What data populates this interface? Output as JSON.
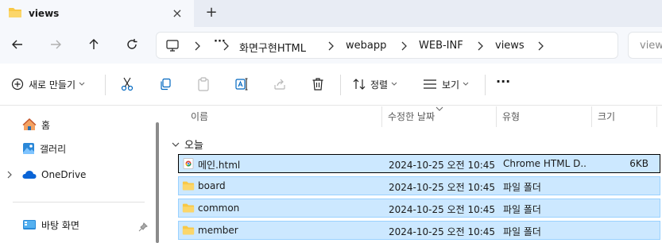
{
  "window": {
    "tab_title": "views",
    "close_glyph": "×",
    "newtab_glyph": "+"
  },
  "address": {
    "more": "···",
    "crumbs": [
      "화면구현HTML",
      "webapp",
      "WEB-INF",
      "views"
    ],
    "search_placeholder": "view"
  },
  "toolbar": {
    "new_label": "새로 만들기",
    "sort_label": "정렬",
    "view_label": "보기",
    "more_glyph": "···"
  },
  "nav": {
    "items": [
      {
        "label": "홈",
        "icon": "home-icon"
      },
      {
        "label": "갤러리",
        "icon": "gallery-icon"
      },
      {
        "label": "OneDrive",
        "icon": "cloud-icon"
      },
      {
        "label": "바탕 화면",
        "icon": "desktop-icon"
      }
    ]
  },
  "columns": {
    "name": "이름",
    "date": "수정한 날짜",
    "type": "유형",
    "size": "크기"
  },
  "group": {
    "label": "오늘"
  },
  "files": [
    {
      "name": "메인.html",
      "date": "2024-10-25 오전 10:45",
      "type": "Chrome HTML D...",
      "size": "6KB",
      "icon": "chrome-html-icon"
    },
    {
      "name": "board",
      "date": "2024-10-25 오전 10:45",
      "type": "파일 폴더",
      "size": "",
      "icon": "folder-icon"
    },
    {
      "name": "common",
      "date": "2024-10-25 오전 10:45",
      "type": "파일 폴더",
      "size": "",
      "icon": "folder-icon"
    },
    {
      "name": "member",
      "date": "2024-10-25 오전 10:45",
      "type": "파일 폴더",
      "size": "",
      "icon": "folder-icon"
    }
  ],
  "colors": {
    "selection": "#cce8ff",
    "selection_border": "#99d1ff",
    "folder": "#f8c846",
    "accent": "#0067c0"
  }
}
